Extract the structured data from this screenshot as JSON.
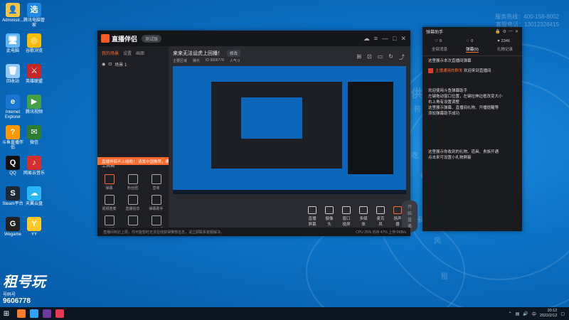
{
  "desktop": {
    "contact_lines": [
      "服务热线：400-158-8002",
      "客服电话：13012328415"
    ],
    "bg_texts": [
      "供",
      "符",
      "吃",
      "号",
      "凤",
      "租",
      "民",
      "风"
    ],
    "icons": [
      {
        "label": "Administr...",
        "color": "#f4c542",
        "glyph": "👤"
      },
      {
        "label": "腾讯电脑管家",
        "color": "#1e88e5",
        "glyph": "选"
      },
      {
        "label": "此电脑",
        "color": "#64b5f6",
        "glyph": "🖥"
      },
      {
        "label": "谷歌浏览",
        "color": "#fbbc05",
        "glyph": "◎"
      },
      {
        "label": "回收站",
        "color": "#90caf9",
        "glyph": "🗑"
      },
      {
        "label": "英雄联盟",
        "color": "#c62828",
        "glyph": "⚔"
      },
      {
        "label": "Internet Explorer",
        "color": "#1976d2",
        "glyph": "e"
      },
      {
        "label": "腾讯视频",
        "color": "#43a047",
        "glyph": "▶"
      },
      {
        "label": "斗鱼直播伴侣",
        "color": "#ff9800",
        "glyph": "?"
      },
      {
        "label": "微信",
        "color": "#2e7d32",
        "glyph": "✉"
      },
      {
        "label": "QQ",
        "color": "#111111",
        "glyph": "Q"
      },
      {
        "label": "网易云音乐",
        "color": "#d32f2f",
        "glyph": "♪"
      },
      {
        "label": "Steam平台",
        "color": "#1b2838",
        "glyph": "S"
      },
      {
        "label": "天翼云盘",
        "color": "#29b6f6",
        "glyph": "☁"
      },
      {
        "label": "Wegame",
        "color": "#212121",
        "glyph": "G"
      },
      {
        "label": "YY",
        "color": "#ffca28",
        "glyph": "Y"
      }
    ],
    "rent_label": "租号玩",
    "rent_sub": "号码号",
    "rent_number": "9606778"
  },
  "main_window": {
    "app_name": "直播伴侣",
    "version": "测试版",
    "left_tabs": [
      "我的场景",
      "设置",
      "画面"
    ],
    "scene_label": "场景 1",
    "tools_title": "工具箱",
    "tools": [
      "弹幕",
      "粉丝团",
      "营收",
      "视频连麦",
      "直播信息",
      "弹幕助手",
      "直播间",
      "点歌",
      "直播伴侣"
    ],
    "banner_text": "直播伴侣不上线啦！ 请发中国推荐，确保推荐使用你的流程",
    "stream_title": "来来无法设虎上回播！",
    "edit_label": "修改",
    "info_items": [
      "主要区域",
      "娱乐",
      "ID 9606778",
      "人气 0"
    ],
    "bottom_tools": [
      "直播屏幕",
      "摄像头",
      "窗口投屏",
      "多媒体",
      "麦克风",
      "扬声器"
    ],
    "live_button": "开始直播",
    "status_left": "直播间到达上限，你可能暂时无法在线获得推荐信息，请立即联系客服解决。",
    "status_right": "CPU 25%  内存 47%  上传:0KB/s"
  },
  "danmu_window": {
    "title": "弹幕助手",
    "stats": [
      {
        "icon": "♡",
        "value": "0"
      },
      {
        "icon": "♢",
        "value": "0"
      },
      {
        "icon": "♥",
        "value": "2346"
      }
    ],
    "tabs": [
      "全部消息",
      "弹幕(0)",
      "礼物记录"
    ],
    "messages": [
      {
        "text": "这里展示本次直播间弹幕",
        "tag": false
      },
      {
        "text": "欢迎来到直播间",
        "tag": true,
        "prefix": "主播通用的群发"
      },
      {
        "text": "欢迎使用斗鱼弹幕助手\n左键拖动窗口位置，左键拉伸边框改变大小\n右上角有设置调整\n这里展示弹幕、直播间礼物、开播提醒等\n添加弹幕助手成功",
        "tag": false
      },
      {
        "text": "这里展示你收到的礼物、道具、贵族开通\n点击来可设置小礼物屏蔽",
        "tag": false
      }
    ]
  },
  "taskbar": {
    "time": "20:12",
    "date": "2022/2/12",
    "tray_lang": "中",
    "apps": [
      {
        "color": "#ff7a29"
      },
      {
        "color": "#2ea2f8"
      },
      {
        "color": "#6b3a9c"
      },
      {
        "color": "#e63950"
      }
    ]
  }
}
